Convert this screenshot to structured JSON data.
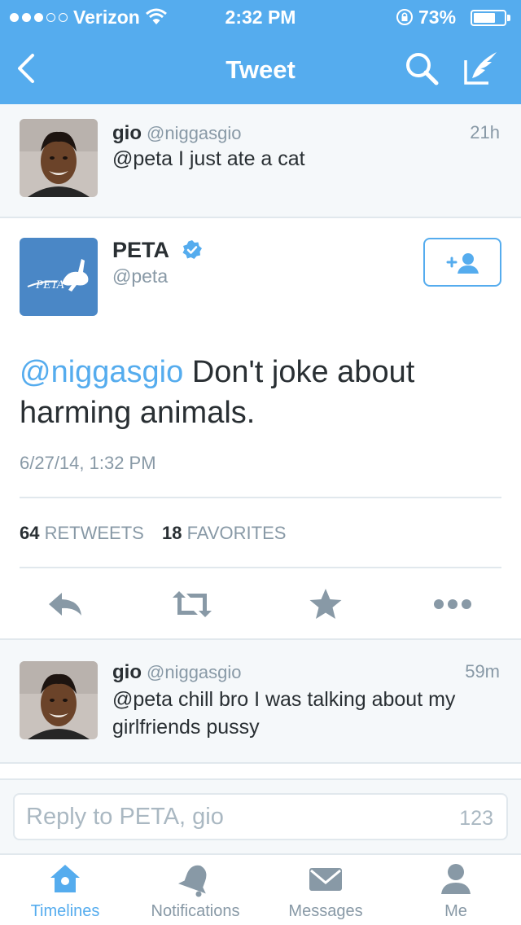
{
  "status_bar": {
    "carrier": "Verizon",
    "time": "2:32 PM",
    "battery": "73%",
    "battery_level": 0.73
  },
  "nav": {
    "title": "Tweet",
    "back_icon": "chevron-left-icon",
    "search_icon": "search-icon",
    "compose_icon": "compose-icon"
  },
  "parent_tweet": {
    "name": "gio",
    "handle": "@niggasgio",
    "age": "21h",
    "text": "@peta I just ate a cat"
  },
  "main_tweet": {
    "name": "PETA",
    "handle": "@peta",
    "logo_text": "PETA",
    "mention": "@niggasgio",
    "text": " Don't joke about harming animals.",
    "timestamp": "6/27/14, 1:32 PM",
    "retweets_count": "64",
    "retweets_label": "RETWEETS",
    "favorites_count": "18",
    "favorites_label": "FAVORITES"
  },
  "reply_tweet": {
    "name": "gio",
    "handle": "@niggasgio",
    "age": "59m",
    "text": "@peta chill bro I was talking about my girlfriends pussy"
  },
  "composer": {
    "placeholder": "Reply to PETA, gio",
    "char_count": "123"
  },
  "tabs": [
    {
      "label": "Timelines",
      "icon": "home-icon",
      "active": true
    },
    {
      "label": "Notifications",
      "icon": "bell-icon",
      "active": false
    },
    {
      "label": "Messages",
      "icon": "envelope-icon",
      "active": false
    },
    {
      "label": "Me",
      "icon": "person-icon",
      "active": false
    }
  ],
  "colors": {
    "brand": "#55acee",
    "muted": "#8899a6",
    "text": "#292f33",
    "peta_blue": "#4a87c6"
  }
}
